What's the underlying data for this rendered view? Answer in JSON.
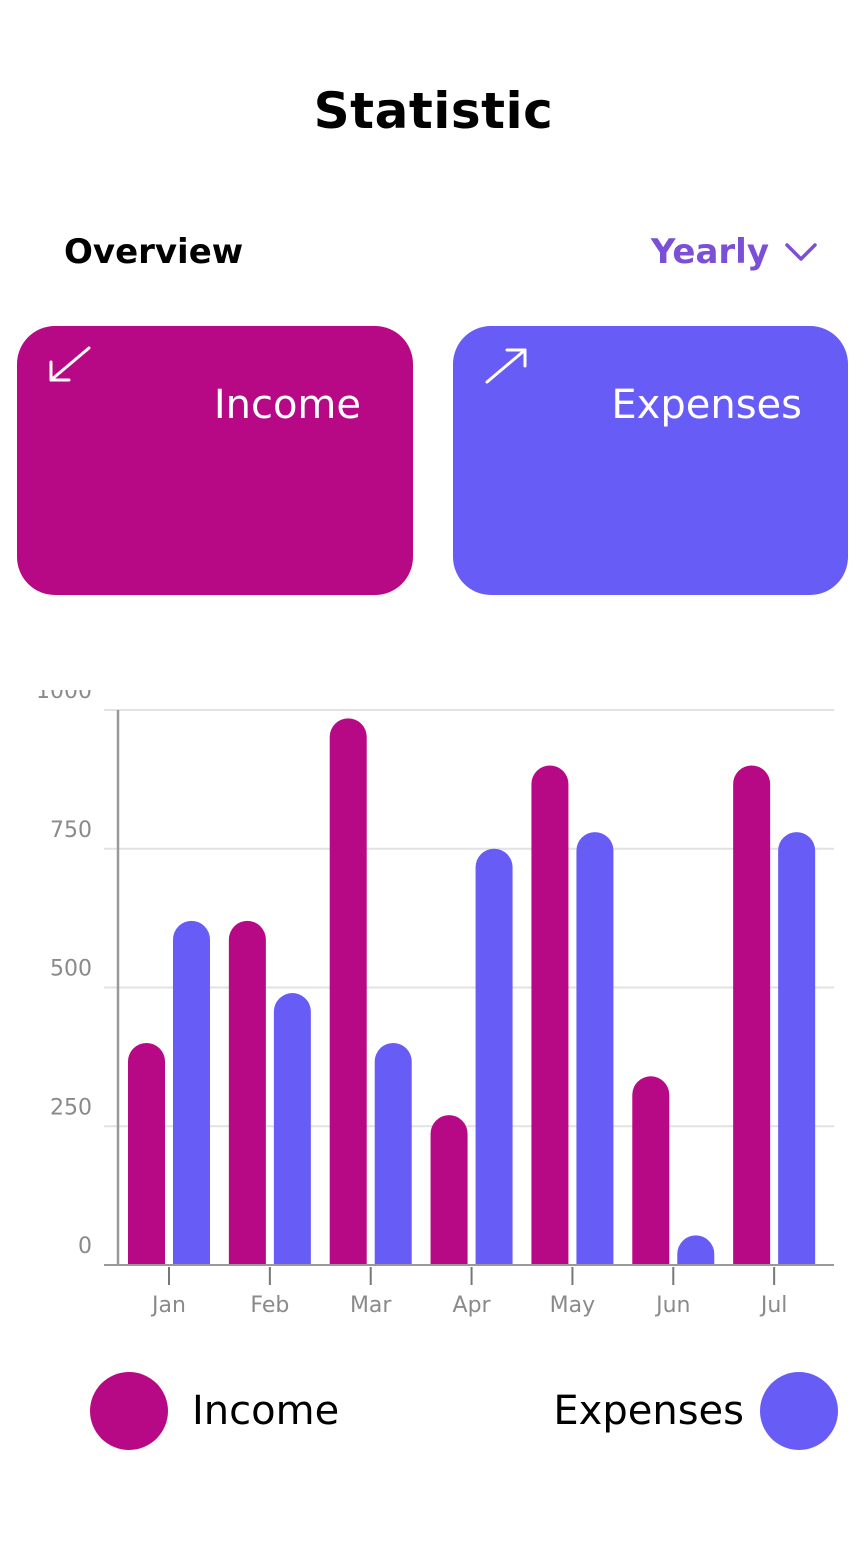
{
  "header": {
    "title": "Statistic"
  },
  "overview": {
    "label": "Overview",
    "period": "Yearly"
  },
  "cards": [
    {
      "label": "Income",
      "icon": "arrow-down-left-icon",
      "color": "#b70985"
    },
    {
      "label": "Expenses",
      "icon": "arrow-up-right-icon",
      "color": "#675cf6"
    }
  ],
  "chart_data": {
    "type": "bar",
    "categories": [
      "Jan",
      "Feb",
      "Mar",
      "Apr",
      "May",
      "Jun",
      "Jul"
    ],
    "series": [
      {
        "name": "Income",
        "color": "#b70985",
        "values": [
          400,
          620,
          985,
          270,
          900,
          340,
          900
        ]
      },
      {
        "name": "Expenses",
        "color": "#675cf6",
        "values": [
          620,
          490,
          400,
          750,
          780,
          40,
          780
        ]
      }
    ],
    "yticks": [
      0,
      250,
      500,
      750,
      1000
    ],
    "ylim": [
      0,
      1000
    ],
    "grid": true,
    "legend_position": "bottom"
  },
  "legend": [
    {
      "label": "Income",
      "color": "#b70985"
    },
    {
      "label": "Expenses",
      "color": "#675cf6"
    }
  ]
}
